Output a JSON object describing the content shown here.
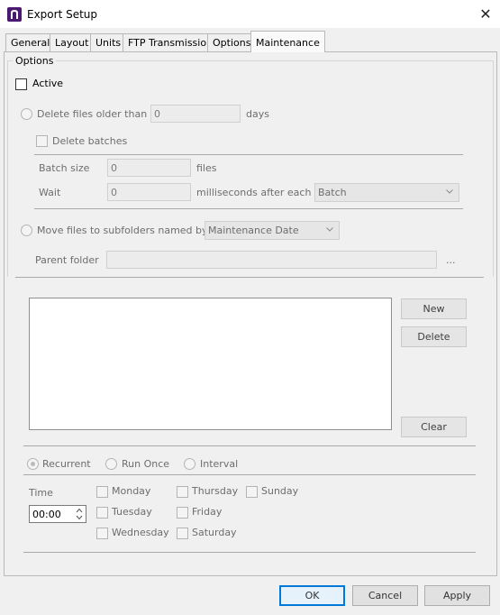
{
  "window": {
    "title": "Export Setup",
    "close_icon": "close-icon"
  },
  "tabs": [
    {
      "label": "General"
    },
    {
      "label": "Layout"
    },
    {
      "label": "Units"
    },
    {
      "label": "FTP Transmission"
    },
    {
      "label": "Options"
    },
    {
      "label": "Maintenance",
      "active": true
    }
  ],
  "options_group": {
    "title": "Options",
    "active_label": "Active",
    "delete_older_label": "Delete files older than",
    "delete_older_value": "0",
    "days_label": "days",
    "delete_batches_label": "Delete batches",
    "batch_size_label": "Batch size",
    "batch_size_value": "0",
    "files_label": "files",
    "wait_label": "Wait",
    "wait_value": "0",
    "ms_label": "milliseconds after each",
    "batch_select_value": "Batch",
    "move_files_label": "Move files to subfolders named by",
    "move_select_value": "Maintenance Date",
    "parent_folder_label": "Parent folder",
    "parent_folder_value": "",
    "browse_label": "..."
  },
  "schedule": {
    "new_label": "New",
    "delete_label": "Delete",
    "clear_label": "Clear",
    "recurrent_label": "Recurrent",
    "run_once_label": "Run Once",
    "interval_label": "Interval",
    "time_label": "Time",
    "time_value": "00:00",
    "days": {
      "monday": "Monday",
      "tuesday": "Tuesday",
      "wednesday": "Wednesday",
      "thursday": "Thursday",
      "friday": "Friday",
      "saturday": "Saturday",
      "sunday": "Sunday"
    }
  },
  "footer": {
    "ok_label": "OK",
    "cancel_label": "Cancel",
    "apply_label": "Apply"
  },
  "colors": {
    "accent": "#0078d7",
    "app_icon": "#4a1a72"
  }
}
